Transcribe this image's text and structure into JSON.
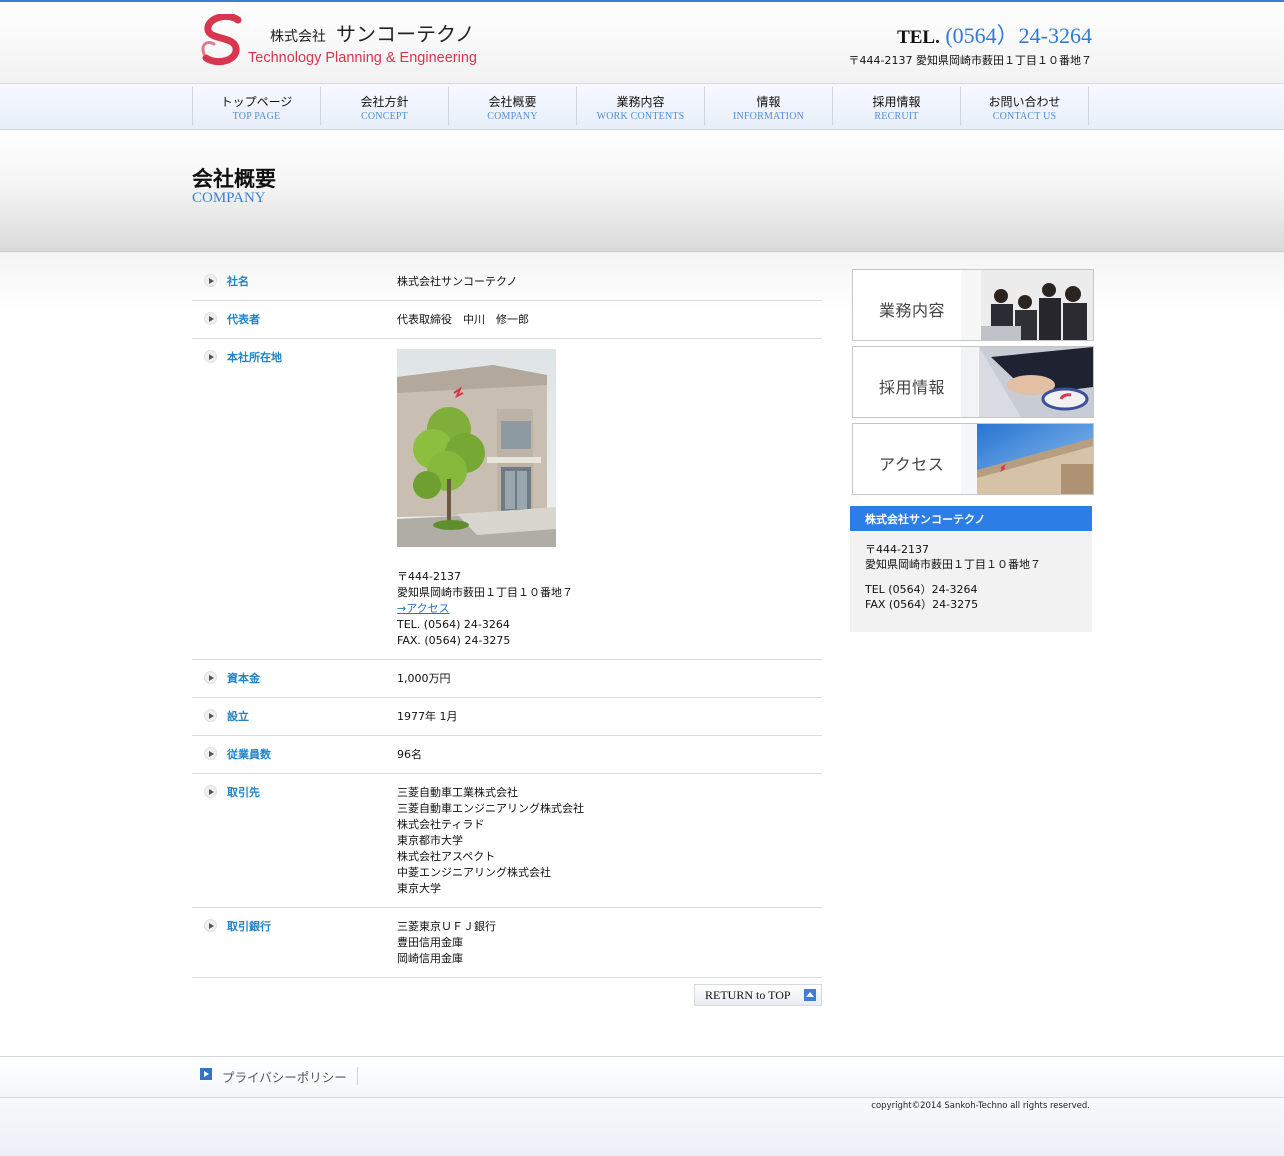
{
  "header": {
    "logo_company_prefix": "株式会社",
    "logo_company_name": "サンコーテクノ",
    "logo_tagline": "Technology Planning & Engineering",
    "tel_label": "TEL.",
    "tel_number": "(0564）24-3264",
    "address": "〒444-2137 愛知県岡崎市薮田１丁目１０番地７"
  },
  "nav": {
    "items": [
      {
        "ja": "トップページ",
        "en": "TOP PAGE"
      },
      {
        "ja": "会社方針",
        "en": "CONCEPT"
      },
      {
        "ja": "会社概要",
        "en": "COMPANY"
      },
      {
        "ja": "業務内容",
        "en": "WORK CONTENTS"
      },
      {
        "ja": "情報",
        "en": "INFORMATION"
      },
      {
        "ja": "採用情報",
        "en": "RECRUIT"
      },
      {
        "ja": "お問い合わせ",
        "en": "CONTACT US"
      }
    ]
  },
  "page": {
    "title": "会社概要",
    "subtitle": "COMPANY"
  },
  "company_table": {
    "rows": [
      {
        "label": "社名",
        "lines": [
          "株式会社サンコーテクノ"
        ]
      },
      {
        "label": "代表者",
        "lines": [
          "代表取締役　中川　修一郎"
        ]
      },
      {
        "label": "本社所在地",
        "postal": "〒444-2137",
        "address": "愛知県岡崎市薮田１丁目１０番地７",
        "access_link": "→アクセス",
        "tel": "TEL. (0564) 24-3264",
        "fax": "FAX. (0564) 24-3275"
      },
      {
        "label": "資本金",
        "lines": [
          "1,000万円"
        ]
      },
      {
        "label": "設立",
        "lines": [
          "1977年 1月"
        ]
      },
      {
        "label": "従業員数",
        "lines": [
          "96名"
        ]
      },
      {
        "label": "取引先",
        "lines": [
          "三菱自動車工業株式会社",
          "三菱自動車エンジニアリング株式会社",
          "株式会社ティラド",
          "東京都市大学",
          "株式会社アスペクト",
          "中菱エンジニアリング株式会社",
          "東京大学"
        ]
      },
      {
        "label": "取引銀行",
        "lines": [
          "三菱東京ＵＦＪ銀行",
          "豊田信用金庫",
          "岡崎信用金庫"
        ]
      }
    ],
    "return_label": "RETURN to TOP"
  },
  "sidebar": {
    "banners": [
      {
        "label": "業務内容"
      },
      {
        "label": "採用情報"
      },
      {
        "label": "アクセス"
      }
    ],
    "info": {
      "heading": "株式会社サンコーテクノ",
      "postal": "〒444-2137",
      "address": "愛知県岡崎市薮田１丁目１０番地７",
      "tel": "TEL (0564）24-3264",
      "fax": "FAX (0564）24-3275"
    }
  },
  "footer": {
    "privacy_label": "プライバシーポリシー",
    "copyright": "copyright©2014 Sankoh-Techno all rights reserved."
  },
  "colors": {
    "accent": "#2c7ee6",
    "label_blue": "#1e83c9",
    "logo_red": "#d8354f"
  }
}
